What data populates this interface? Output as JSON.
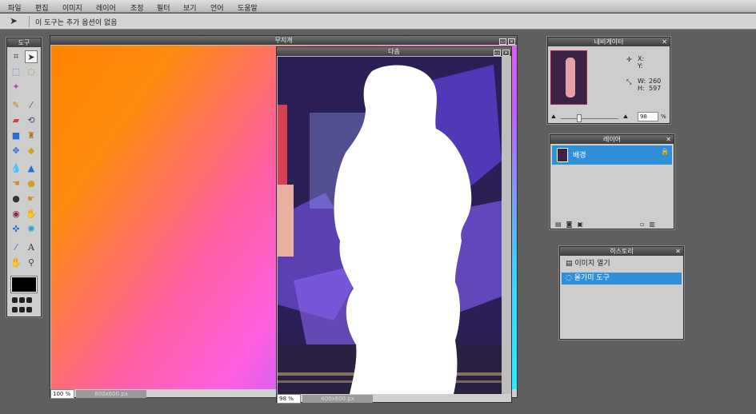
{
  "menu": {
    "items": [
      "파일",
      "편집",
      "이미지",
      "레이어",
      "조정",
      "필터",
      "보기",
      "언어",
      "도움말"
    ]
  },
  "options_bar": {
    "message": "이 도구는 추가 옵션이 없음"
  },
  "tools_panel": {
    "title": "도구",
    "primary_color": "#000000"
  },
  "doc1": {
    "title": "무지개",
    "zoom": "100",
    "zoom_unit": "%",
    "size": "800x600 px",
    "gradient_colors": [
      "#ff8a00",
      "#ff5fd0",
      "#22e8ff"
    ]
  },
  "doc2": {
    "title": "다솜",
    "zoom": "98",
    "zoom_unit": "%",
    "size": "400x600 px"
  },
  "navigator": {
    "title": "네비게이터",
    "x_label": "X:",
    "y_label": "Y:",
    "w_label": "W:",
    "w_value": "260",
    "h_label": "H:",
    "h_value": "597",
    "zoom": "98",
    "zoom_unit": "%"
  },
  "layers": {
    "title": "레이어",
    "items": [
      {
        "name": "배경"
      }
    ]
  },
  "history": {
    "title": "히스토리",
    "items": [
      {
        "label": "이미지 열기"
      },
      {
        "label": "올가미 도구"
      }
    ]
  }
}
